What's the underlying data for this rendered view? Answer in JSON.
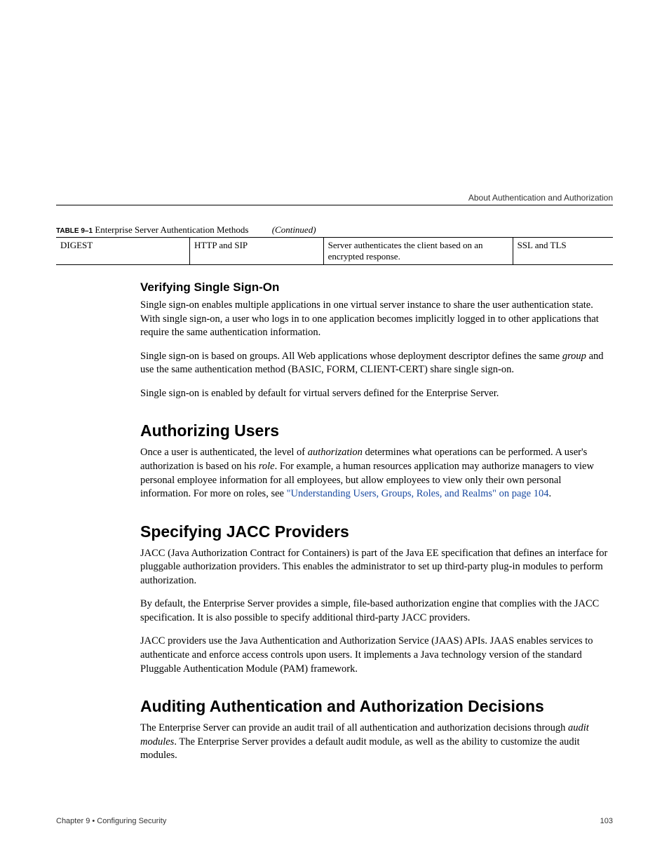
{
  "header": {
    "section_title": "About Authentication and Authorization"
  },
  "table": {
    "label": "TABLE 9–1",
    "title": "Enterprise Server Authentication Methods",
    "continued": "(Continued)",
    "row": {
      "c1": "DIGEST",
      "c2": "HTTP and SIP",
      "c3": "Server authenticates the client based on an encrypted response.",
      "c4": "SSL and TLS"
    }
  },
  "sso": {
    "heading": "Verifying Single Sign-On",
    "p1": "Single sign-on enables multiple applications in one virtual server instance to share the user authentication state. With single sign-on, a user who logs in to one application becomes implicitly logged in to other applications that require the same authentication information.",
    "p2a": "Single sign-on is based on groups. All Web applications whose deployment descriptor defines the same ",
    "p2_em": "group",
    "p2b": " and use the same authentication method (BASIC, FORM, CLIENT-CERT) share single sign-on.",
    "p3": "Single sign-on is enabled by default for virtual servers defined for the Enterprise Server."
  },
  "auth_users": {
    "heading": "Authorizing Users",
    "p1a": "Once a user is authenticated, the level of ",
    "p1_em1": "authorization",
    "p1b": " determines what operations can be performed. A user's authorization is based on his ",
    "p1_em2": "role",
    "p1c": ". For example, a human resources application may authorize managers to view personal employee information for all employees, but allow employees to view only their own personal information. For more on roles, see ",
    "link": "\"Understanding Users, Groups, Roles, and Realms\" on page 104",
    "p1d": "."
  },
  "jacc": {
    "heading": "Specifying JACC Providers",
    "p1": "JACC (Java Authorization Contract for Containers) is part of the Java EE specification that defines an interface for pluggable authorization providers. This enables the administrator to set up third-party plug-in modules to perform authorization.",
    "p2": "By default, the Enterprise Server provides a simple, file-based authorization engine that complies with the JACC specification. It is also possible to specify additional third-party JACC providers.",
    "p3": "JACC providers use the Java Authentication and Authorization Service (JAAS) APIs. JAAS enables services to authenticate and enforce access controls upon users. It implements a Java technology version of the standard Pluggable Authentication Module (PAM) framework."
  },
  "audit": {
    "heading": "Auditing Authentication and Authorization Decisions",
    "p1a": "The Enterprise Server can provide an audit trail of all authentication and authorization decisions through ",
    "p1_em": "audit modules",
    "p1b": ". The Enterprise Server provides a default audit module, as well as the ability to customize the audit modules."
  },
  "footer": {
    "chapter": "Chapter 9 • Configuring Security",
    "page": "103"
  }
}
